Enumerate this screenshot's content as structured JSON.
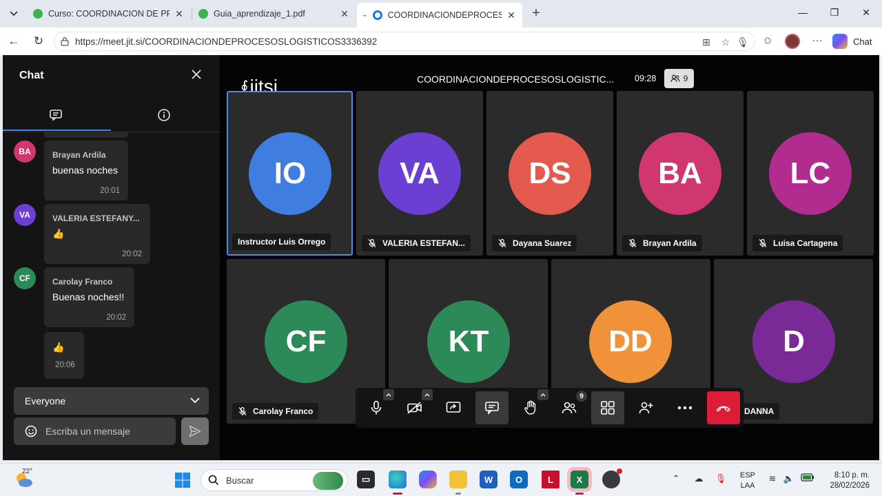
{
  "browser": {
    "tabs": [
      {
        "title": "Curso: COORDINACION DE PROCE",
        "favicon_color": "#39b54a",
        "active": false
      },
      {
        "title": "Guia_aprendizaje_1.pdf",
        "favicon_color": "#39b54a",
        "active": false
      },
      {
        "title": "COORDINACIONDEPROCESOS",
        "favicon_color": "#1a73e8",
        "active": true
      }
    ],
    "url": "https://meet.jit.si/COORDINACIONDEPROCESOSLOGISTICOS3336392",
    "chat_button_label": "Chat"
  },
  "chat": {
    "title": "Chat",
    "messages": [
      {
        "initials": "BA",
        "avatar_color": "#d03771",
        "sender": "Brayan Ardila",
        "text": "buenas noches",
        "time": "20:01"
      },
      {
        "initials": "VA",
        "avatar_color": "#6a3fd1",
        "sender": "VALERIA ESTEFANY...",
        "text": "👍",
        "time": "20:02"
      },
      {
        "initials": "CF",
        "avatar_color": "#2b8a57",
        "sender": "Carolay Franco",
        "text": "Buenas noches!!",
        "time": "20:02"
      },
      {
        "initials": "",
        "avatar_color": "",
        "sender": "",
        "text": "👍",
        "time": "20:06"
      }
    ],
    "recipient": "Everyone",
    "input_placeholder": "Escriba un mensaje"
  },
  "meeting": {
    "logo_text": "jitsi",
    "title": "COORDINACIONDEPROCESOSLOGISTIC...",
    "timer": "09:28",
    "participant_count": "9"
  },
  "participants": [
    {
      "initials": "IO",
      "name": "Instructor Luis Orrego",
      "color": "#3f7ee0",
      "muted": false,
      "active": true
    },
    {
      "initials": "VA",
      "name": "VALERIA ESTEFAN...",
      "color": "#6a3fd1",
      "muted": true,
      "active": false
    },
    {
      "initials": "DS",
      "name": "Dayana Suarez",
      "color": "#e45a4f",
      "muted": true,
      "active": false
    },
    {
      "initials": "BA",
      "name": "Brayan Ardila",
      "color": "#d03771",
      "muted": true,
      "active": false
    },
    {
      "initials": "LC",
      "name": "Luisa Cartagena",
      "color": "#b22b8f",
      "muted": true,
      "active": false
    },
    {
      "initials": "CF",
      "name": "Carolay Franco",
      "color": "#2b8a57",
      "muted": true,
      "active": false
    },
    {
      "initials": "KT",
      "name": "",
      "color": "#2b8a57",
      "muted": false,
      "active": false
    },
    {
      "initials": "DD",
      "name": "",
      "color": "#ef923a",
      "muted": false,
      "active": false
    },
    {
      "initials": "D",
      "name": "DANNA",
      "color": "#7a2a96",
      "muted": false,
      "active": false
    }
  ],
  "toolbar": {
    "participants_badge": "9",
    "buttons": [
      "microphone",
      "camera",
      "share-screen",
      "chat",
      "raise-hand",
      "participants",
      "tile-view",
      "invite",
      "more",
      "hangup"
    ]
  },
  "taskbar": {
    "temperature": "22°",
    "search_placeholder": "Buscar",
    "language_line1": "ESP",
    "language_line2": "LAA",
    "time": "8:10 p. m.",
    "date": "28/02/2026"
  }
}
